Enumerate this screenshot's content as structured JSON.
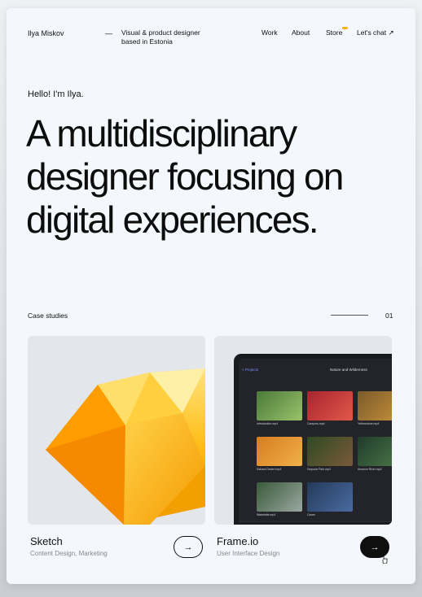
{
  "header": {
    "brand": "Ilya Miskov",
    "dash": "—",
    "tagline": "Visual & product designer based in Estonia",
    "nav": {
      "work": "Work",
      "about": "About",
      "store": "Store",
      "chat": "Let's chat ↗"
    }
  },
  "hero": {
    "greeting": "Hello! I'm Ilya.",
    "headline": "A multidisciplinary designer focusing on digital experiences."
  },
  "section": {
    "label": "Case studies",
    "number": "01"
  },
  "projects": [
    {
      "title": "Sketch",
      "subtitle": "Content Design, Marketing",
      "button": "→"
    },
    {
      "title": "Frame.io",
      "subtitle": "User Interface Design",
      "button": "→"
    }
  ],
  "frameio_screen": {
    "back": "< Projects",
    "title": "Nature and Wilderness",
    "tiles": [
      "Introduction.mp4",
      "Canyons.mp4",
      "Yellowstone.mp4",
      "Sahara Desert.mp4",
      "Sequoia Park.mp4",
      "Amazon River.mp4",
      "Waterfalls.mp4",
      "Caves"
    ]
  },
  "colors": {
    "store_dot": "#f5b400",
    "accent_dark": "#0f0f10"
  }
}
